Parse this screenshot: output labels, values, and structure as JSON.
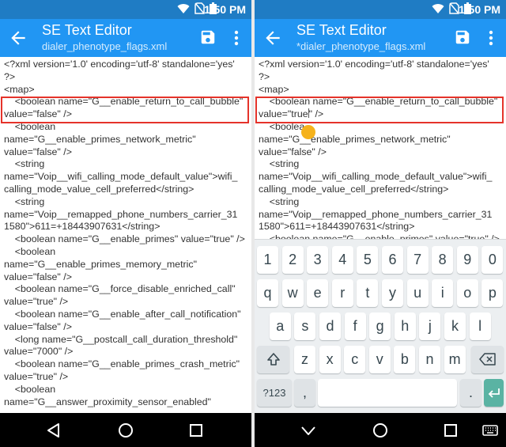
{
  "status": {
    "time": "1:50 PM"
  },
  "app": {
    "title": "SE Text Editor",
    "left_file": "dialer_phenotype_flags.xml",
    "right_file": "*dialer_phenotype_flags.xml"
  },
  "highlight_color": "#e5332a",
  "accent_color": "#2196f3",
  "left_lines": [
    "<?xml version='1.0' encoding='utf-8' standalone='yes'",
    "?>",
    "<map>",
    "    <boolean name=\"G__enable_return_to_call_bubble\"",
    "value=\"false\" />",
    "    <boolean",
    "name=\"G__enable_primes_network_metric\"",
    "value=\"false\" />",
    "    <string",
    "name=\"Voip__wifi_calling_mode_default_value\">wifi_",
    "calling_mode_value_cell_preferred</string>",
    "    <string",
    "name=\"Voip__remapped_phone_numbers_carrier_31",
    "1580\">611=+18443907631</string>",
    "    <boolean name=\"G__enable_primes\" value=\"true\" />",
    "    <boolean",
    "name=\"G__enable_primes_memory_metric\"",
    "value=\"false\" />",
    "    <boolean name=\"G__force_disable_enriched_call\"",
    "value=\"true\" />",
    "    <boolean name=\"G__enable_after_call_notification\"",
    "value=\"false\" />",
    "    <long name=\"G__postcall_call_duration_threshold\"",
    "value=\"7000\" />",
    "    <boolean name=\"G__enable_primes_crash_metric\"",
    "value=\"true\" />",
    "    <boolean",
    "name=\"G__answer_proximity_sensor_enabled\""
  ],
  "right_lines": [
    "<?xml version='1.0' encoding='utf-8' standalone='yes'",
    "?>",
    "<map>",
    "    <boolean name=\"G__enable_return_to_call_bubble\"",
    "value=\"true\" />",
    "    <boolea",
    "name=\"G__enable_primes_network_metric\"",
    "value=\"false\" />",
    "    <string",
    "name=\"Voip__wifi_calling_mode_default_value\">wifi_",
    "calling_mode_value_cell_preferred</string>",
    "    <string",
    "name=\"Voip__remapped_phone_numbers_carrier_31",
    "1580\">611=+18443907631</string>",
    "    <boolean name=\"G__enable_primes\" value=\"true\" />"
  ],
  "keyboard": {
    "numbers": [
      "1",
      "2",
      "3",
      "4",
      "5",
      "6",
      "7",
      "8",
      "9",
      "0"
    ],
    "row1": [
      "q",
      "w",
      "e",
      "r",
      "t",
      "y",
      "u",
      "i",
      "o",
      "p"
    ],
    "row2": [
      "a",
      "s",
      "d",
      "f",
      "g",
      "h",
      "j",
      "k",
      "l"
    ],
    "row3": [
      "z",
      "x",
      "c",
      "v",
      "b",
      "n",
      "m"
    ],
    "symbols_label": "?123",
    "comma": ",",
    "period": "."
  }
}
